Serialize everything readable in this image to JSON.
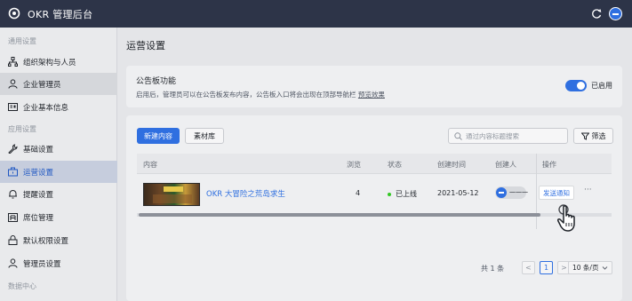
{
  "app": {
    "title": "OKR 管理后台"
  },
  "sidebar": {
    "groups": [
      {
        "title": "通用设置"
      },
      {
        "title": "应用设置"
      },
      {
        "title": "数据中心"
      }
    ],
    "items": [
      {
        "label": "组织架构与人员",
        "icon": "org-icon"
      },
      {
        "label": "企业管理员",
        "icon": "user-icon"
      },
      {
        "label": "企业基本信息",
        "icon": "info-card-icon"
      },
      {
        "label": "基础设置",
        "icon": "wrench-icon"
      },
      {
        "label": "运营设置",
        "icon": "briefcase-icon"
      },
      {
        "label": "提醒设置",
        "icon": "bell-icon"
      },
      {
        "label": "席位管理",
        "icon": "seat-icon"
      },
      {
        "label": "默认权限设置",
        "icon": "lock-icon"
      },
      {
        "label": "管理员设置",
        "icon": "user-icon"
      }
    ]
  },
  "main": {
    "page_title": "运营设置",
    "notice": {
      "title": "公告板功能",
      "desc": "启用后，管理员可以在公告板发布内容，公告板入口将会出现在顶部导航栏",
      "preview_link": "预览效果",
      "toggle_label": "已启用",
      "toggle_on": true
    },
    "toolbar": {
      "new_button": "新建内容",
      "library_button": "素材库",
      "search_placeholder": "通过内容标题搜索",
      "filter_button": "筛选"
    },
    "table": {
      "headers": [
        "内容",
        "浏览",
        "状态",
        "创建时间",
        "创建人",
        "操作"
      ],
      "rows": [
        {
          "title": "OKR 大冒险之荒岛求生",
          "views": "4",
          "status": "已上线",
          "created": "2021-05-12",
          "creator": "一一一",
          "action_send": "发送通知",
          "action_more": "···"
        }
      ]
    },
    "pagination": {
      "total": "共 1 条",
      "prev": "<",
      "current": "1",
      "next": ">",
      "page_size": "10 条/页"
    }
  },
  "colors": {
    "accent": "#2f6fe0",
    "topbar": "#2d3448",
    "status_online": "#34c724"
  }
}
